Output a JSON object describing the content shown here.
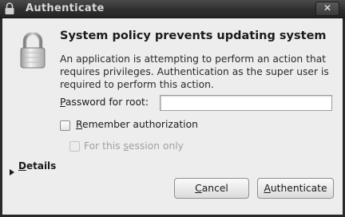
{
  "window": {
    "title": "Authenticate",
    "close_glyph": "✕"
  },
  "icons": {
    "title_icon": "lock-icon",
    "dialog_icon": "padlock-icon",
    "details_icon": "triangle-right-icon"
  },
  "dialog": {
    "heading": "System policy prevents updating system",
    "message": "An application is attempting to perform an action that requires privileges. Authentication as the super user is required to perform this action.",
    "password_label_mnemonic": "P",
    "password_label_rest": "assword for root:",
    "password_value": "",
    "remember_checked": false,
    "remember_mnemonic": "R",
    "remember_rest": "emember authorization",
    "session_checked": false,
    "session_enabled": false,
    "session_prefix": "For this ",
    "session_mnemonic": "s",
    "session_rest": "ession only",
    "details_mnemonic": "D",
    "details_rest": "etails",
    "cancel_mnemonic": "C",
    "cancel_rest": "ancel",
    "auth_mnemonic": "A",
    "auth_rest": "uthenticate"
  },
  "colors": {
    "titlebar": "#2f2f2f",
    "dialog_background": "#ededed",
    "disabled_text": "#a0a0a0"
  }
}
